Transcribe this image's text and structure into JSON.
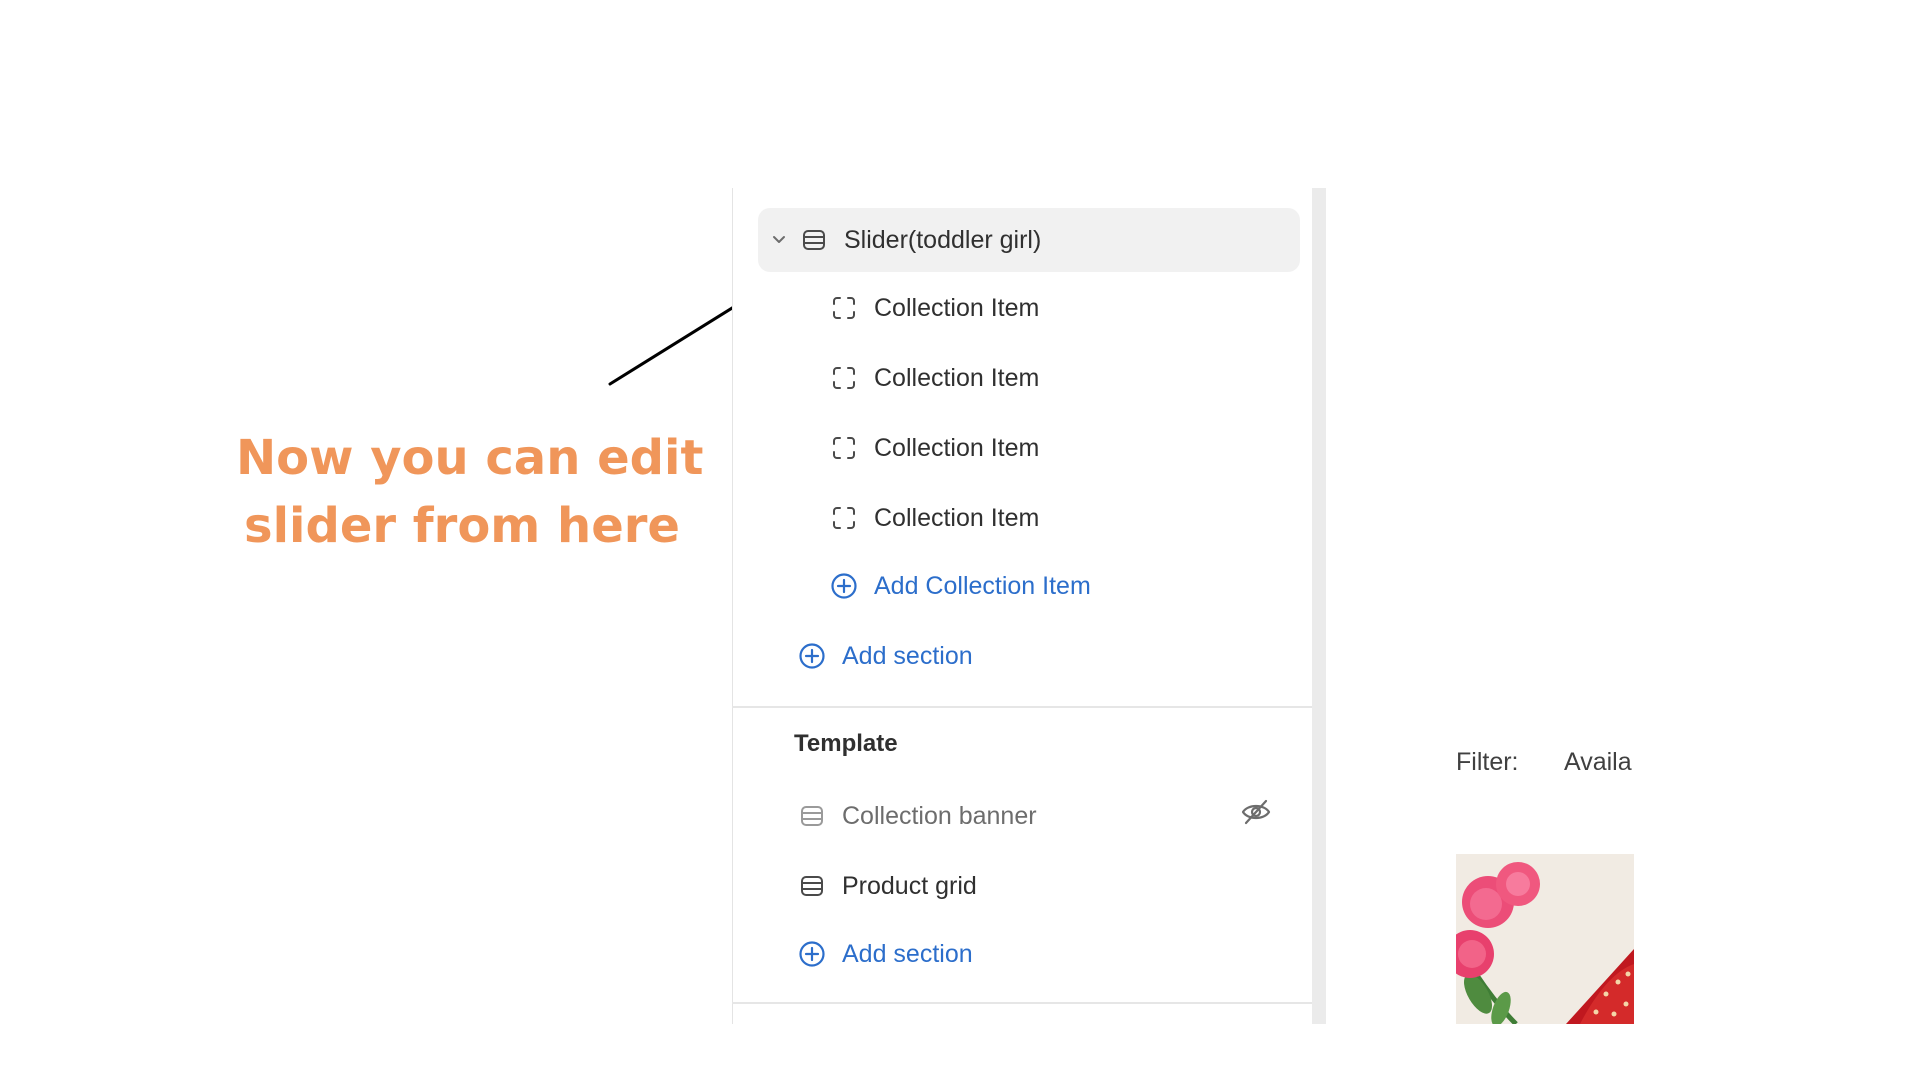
{
  "annotation": {
    "line1": "Now you can edit",
    "line2": "slider from here",
    "color": "#f0965a"
  },
  "sidebar": {
    "slider_section": {
      "label": "Slider(toddler girl)",
      "icon": "section-icon",
      "expanded": true
    },
    "blocks": [
      {
        "label": "Collection Item",
        "icon": "block-icon"
      },
      {
        "label": "Collection Item",
        "icon": "block-icon"
      },
      {
        "label": "Collection Item",
        "icon": "block-icon"
      },
      {
        "label": "Collection Item",
        "icon": "block-icon"
      }
    ],
    "add_block_label": "Add Collection Item",
    "add_section_label": "Add section",
    "template": {
      "title": "Template",
      "items": [
        {
          "label": "Collection banner",
          "icon": "section-icon",
          "hidden": true
        },
        {
          "label": "Product grid",
          "icon": "section-icon",
          "hidden": false
        }
      ],
      "add_section_label": "Add section"
    },
    "accent_color": "#2c6ecb"
  },
  "preview": {
    "filter_label": "Filter:",
    "filter_value": "Availa"
  }
}
